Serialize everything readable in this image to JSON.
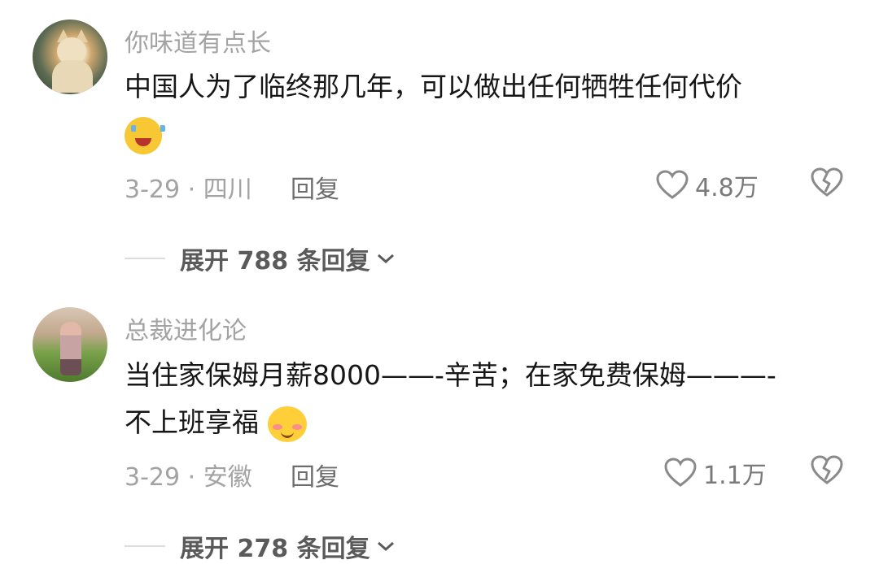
{
  "comments": [
    {
      "username": "你味道有点长",
      "text": "中国人为了临终那几年，可以做出任何牺牲任何代价",
      "emoji": "crying-laughing-emoji",
      "date_location": "3-29 · 四川",
      "reply_label": "回复",
      "likes": "4.8万",
      "expand_label": "展开 788 条回复"
    },
    {
      "username": "总裁进化论",
      "text_line1": "当住家保姆月薪8000——-辛苦；在家免费保姆———-",
      "text_line2": "不上班享福",
      "emoji": "shy-smile-emoji",
      "date_location": "3-29 · 安徽",
      "reply_label": "回复",
      "likes": "1.1万",
      "expand_label": "展开 278 条回复"
    }
  ],
  "colors": {
    "text": "#161616",
    "meta": "#a3a3a3",
    "icon": "#8a8a8a"
  }
}
